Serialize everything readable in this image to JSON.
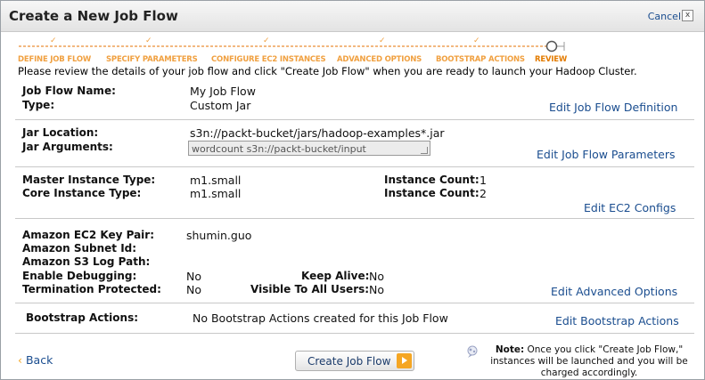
{
  "dialog": {
    "title": "Create a New Job Flow",
    "cancel_label": "Cancel",
    "close_glyph": "x"
  },
  "wizard": {
    "steps": [
      {
        "label": "DEFINE JOB FLOW",
        "state": "complete"
      },
      {
        "label": "SPECIFY PARAMETERS",
        "state": "complete"
      },
      {
        "label": "CONFIGURE EC2 INSTANCES",
        "state": "complete"
      },
      {
        "label": "ADVANCED OPTIONS",
        "state": "complete"
      },
      {
        "label": "BOOTSTRAP ACTIONS",
        "state": "complete"
      },
      {
        "label": "REVIEW",
        "state": "current"
      }
    ],
    "check_glyph": "✓",
    "colors": {
      "complete": "#f0a040",
      "current": "#e37b00"
    }
  },
  "intro": "Please review the details of your job flow and click \"Create Job Flow\" when you are ready to launch your Hadoop Cluster.",
  "sections": {
    "definition": {
      "job_flow_name_label": "Job Flow Name:",
      "job_flow_name": "My Job Flow",
      "type_label": "Type:",
      "type": "Custom Jar",
      "edit_link": "Edit Job Flow Definition"
    },
    "parameters": {
      "jar_location_label": "Jar Location:",
      "jar_location": "s3n://packt-bucket/jars/hadoop-examples*.jar",
      "jar_arguments_label": "Jar Arguments:",
      "jar_arguments": "wordcount s3n://packt-bucket/input",
      "edit_link": "Edit Job Flow Parameters"
    },
    "ec2": {
      "master_type_label": "Master Instance Type:",
      "master_type": "m1.small",
      "core_type_label": "Core Instance Type:",
      "core_type": "m1.small",
      "master_count_label": "Instance Count:",
      "master_count": "1",
      "core_count_label": "Instance Count:",
      "core_count": "2",
      "edit_link": "Edit EC2 Configs"
    },
    "advanced": {
      "key_pair_label": "Amazon EC2 Key Pair:",
      "key_pair": "shumin.guo",
      "subnet_label": "Amazon Subnet Id:",
      "log_path_label": "Amazon S3 Log Path:",
      "debugging_label": "Enable Debugging:",
      "debugging": "No",
      "keep_alive_label": "Keep Alive:",
      "keep_alive": "No",
      "termination_label": "Termination Protected:",
      "termination": "No",
      "visible_label": "Visible To All Users:",
      "visible": "No",
      "edit_link": "Edit Advanced Options"
    },
    "bootstrap": {
      "label": "Bootstrap Actions:",
      "value": "No Bootstrap Actions created for this Job Flow",
      "edit_link": "Edit Bootstrap Actions"
    }
  },
  "footer": {
    "back_label": "Back",
    "back_glyph": "‹",
    "create_label": "Create Job Flow",
    "note_title": "Note:",
    "note_text": "Once you click \"Create Job Flow,\" instances will be launched and you will be charged accordingly."
  },
  "colors": {
    "link": "#1a4d8f",
    "accent": "#f5a623"
  }
}
